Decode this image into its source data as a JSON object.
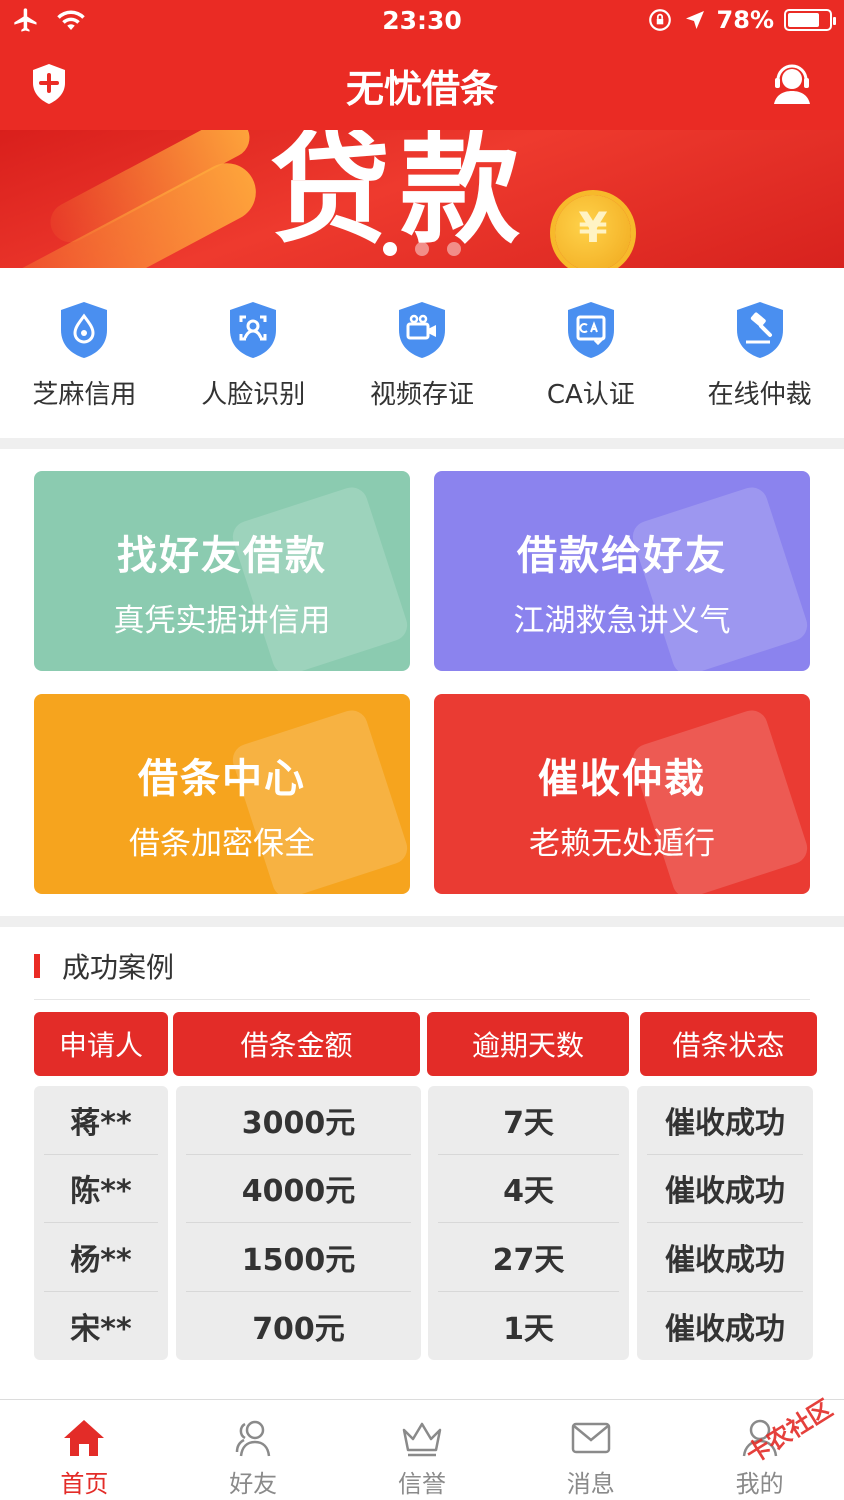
{
  "status_bar": {
    "time": "23:30",
    "battery_text": "78%",
    "battery_level": 0.78
  },
  "header": {
    "title": "无忧借条"
  },
  "banner": {
    "word": "贷款",
    "coin_symbol": "¥",
    "pages": 3,
    "active_page": 1
  },
  "services": [
    {
      "label": "芝麻信用",
      "icon": "sesame-credit-icon"
    },
    {
      "label": "人脸识别",
      "icon": "face-recognition-icon"
    },
    {
      "label": "视频存证",
      "icon": "video-evidence-icon"
    },
    {
      "label": "CA认证",
      "icon": "ca-certificate-icon"
    },
    {
      "label": "在线仲裁",
      "icon": "online-arbitration-icon"
    }
  ],
  "cards": [
    {
      "title": "找好友借款",
      "subtitle": "真凭实据讲信用",
      "color": "#8bcbb0"
    },
    {
      "title": "借款给好友",
      "subtitle": "江湖救急讲义气",
      "color": "#8b83ee"
    },
    {
      "title": "借条中心",
      "subtitle": "借条加密保全",
      "color": "#f6a41e"
    },
    {
      "title": "催收仲裁",
      "subtitle": "老赖无处遁行",
      "color": "#ea3b33"
    }
  ],
  "cases": {
    "title": "成功案例",
    "headers": [
      "申请人",
      "借条金额",
      "逾期天数",
      "借条状态"
    ],
    "rows": [
      [
        "蒋**",
        "3000元",
        "7天",
        "催收成功"
      ],
      [
        "陈**",
        "4000元",
        "4天",
        "催收成功"
      ],
      [
        "杨**",
        "1500元",
        "27天",
        "催收成功"
      ],
      [
        "宋**",
        "700元",
        "1天",
        "催收成功"
      ]
    ]
  },
  "tabbar": [
    {
      "label": "首页",
      "active": true
    },
    {
      "label": "好友",
      "active": false
    },
    {
      "label": "信誉",
      "active": false
    },
    {
      "label": "消息",
      "active": false
    },
    {
      "label": "我的",
      "active": false
    }
  ],
  "watermark": "卡农社区",
  "colors": {
    "brand_red": "#ea2b24",
    "tab_active": "#e32c28",
    "tab_inactive": "#8a8a8a",
    "icon_blue": "#4a8ff0"
  }
}
